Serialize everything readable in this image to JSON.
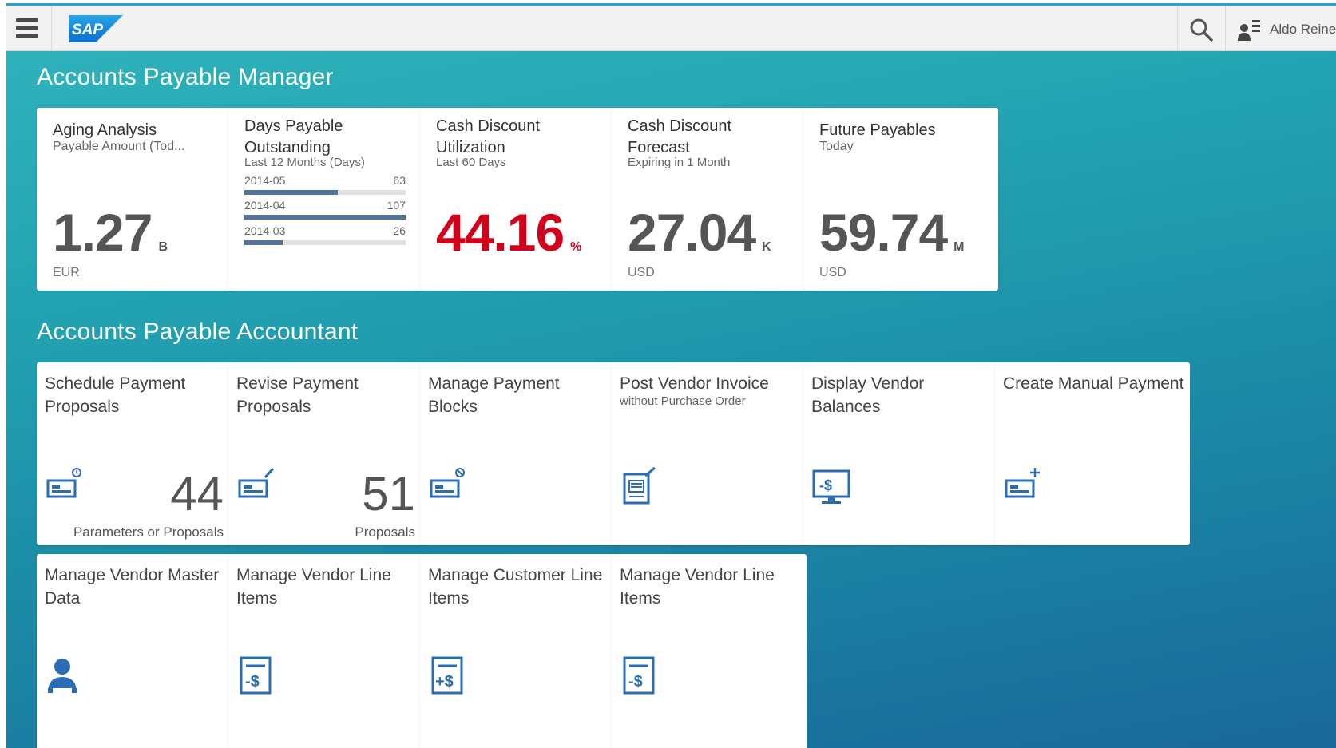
{
  "shell": {
    "logo_text": "SAP",
    "user_name": "Aldo Reine"
  },
  "groups": [
    {
      "title": "Accounts Payable Manager"
    },
    {
      "title": "Accounts Payable Accountant"
    }
  ],
  "kpi_tiles": {
    "aging": {
      "title": "Aging Analysis",
      "subtitle": "Payable Amount (Tod...",
      "value": "1.27",
      "scale": "B",
      "unit": "EUR"
    },
    "dpo": {
      "title": "Days Payable Outstanding",
      "subtitle": "Last 12 Months (Days)",
      "rows": [
        {
          "label": "2014-05",
          "value": "63",
          "fill_pct": 58
        },
        {
          "label": "2014-04",
          "value": "107",
          "fill_pct": 100
        },
        {
          "label": "2014-03",
          "value": "26",
          "fill_pct": 24
        }
      ]
    },
    "cash_util": {
      "title": "Cash Discount Utilization",
      "subtitle": "Last 60 Days",
      "value": "44.16",
      "scale": "%",
      "color": "#d0021b"
    },
    "cash_forecast": {
      "title": "Cash Discount Forecast",
      "subtitle": "Expiring in 1 Month",
      "value": "27.04",
      "scale": "K",
      "unit": "USD"
    },
    "future": {
      "title": "Future Payables",
      "subtitle": "Today",
      "value": "59.74",
      "scale": "M",
      "unit": "USD"
    }
  },
  "app_tiles": [
    {
      "title": "Schedule Payment Proposals",
      "count": "44",
      "info": "Parameters or Proposals",
      "icon": "payment-schedule-icon"
    },
    {
      "title": "Revise Payment Proposals",
      "count": "51",
      "info": "Proposals",
      "icon": "payment-edit-icon"
    },
    {
      "title": "Manage Payment Blocks",
      "icon": "payment-block-icon"
    },
    {
      "title": "Post Vendor Invoice",
      "subtitle": "without Purchase Order",
      "icon": "invoice-post-icon"
    },
    {
      "title": "Display Vendor Balances",
      "icon": "monitor-balance-icon"
    },
    {
      "title": "Create Manual Payment",
      "icon": "payment-add-icon"
    },
    {
      "title": "Manage Vendor Master Data",
      "icon": "person-icon"
    },
    {
      "title": "Manage Vendor Line Items",
      "icon": "document-minus-dollar-icon"
    },
    {
      "title": "Manage Customer Line Items",
      "icon": "document-plus-dollar-icon"
    },
    {
      "title": "Manage Vendor Line Items",
      "icon": "document-minus-dollar-icon"
    }
  ]
}
